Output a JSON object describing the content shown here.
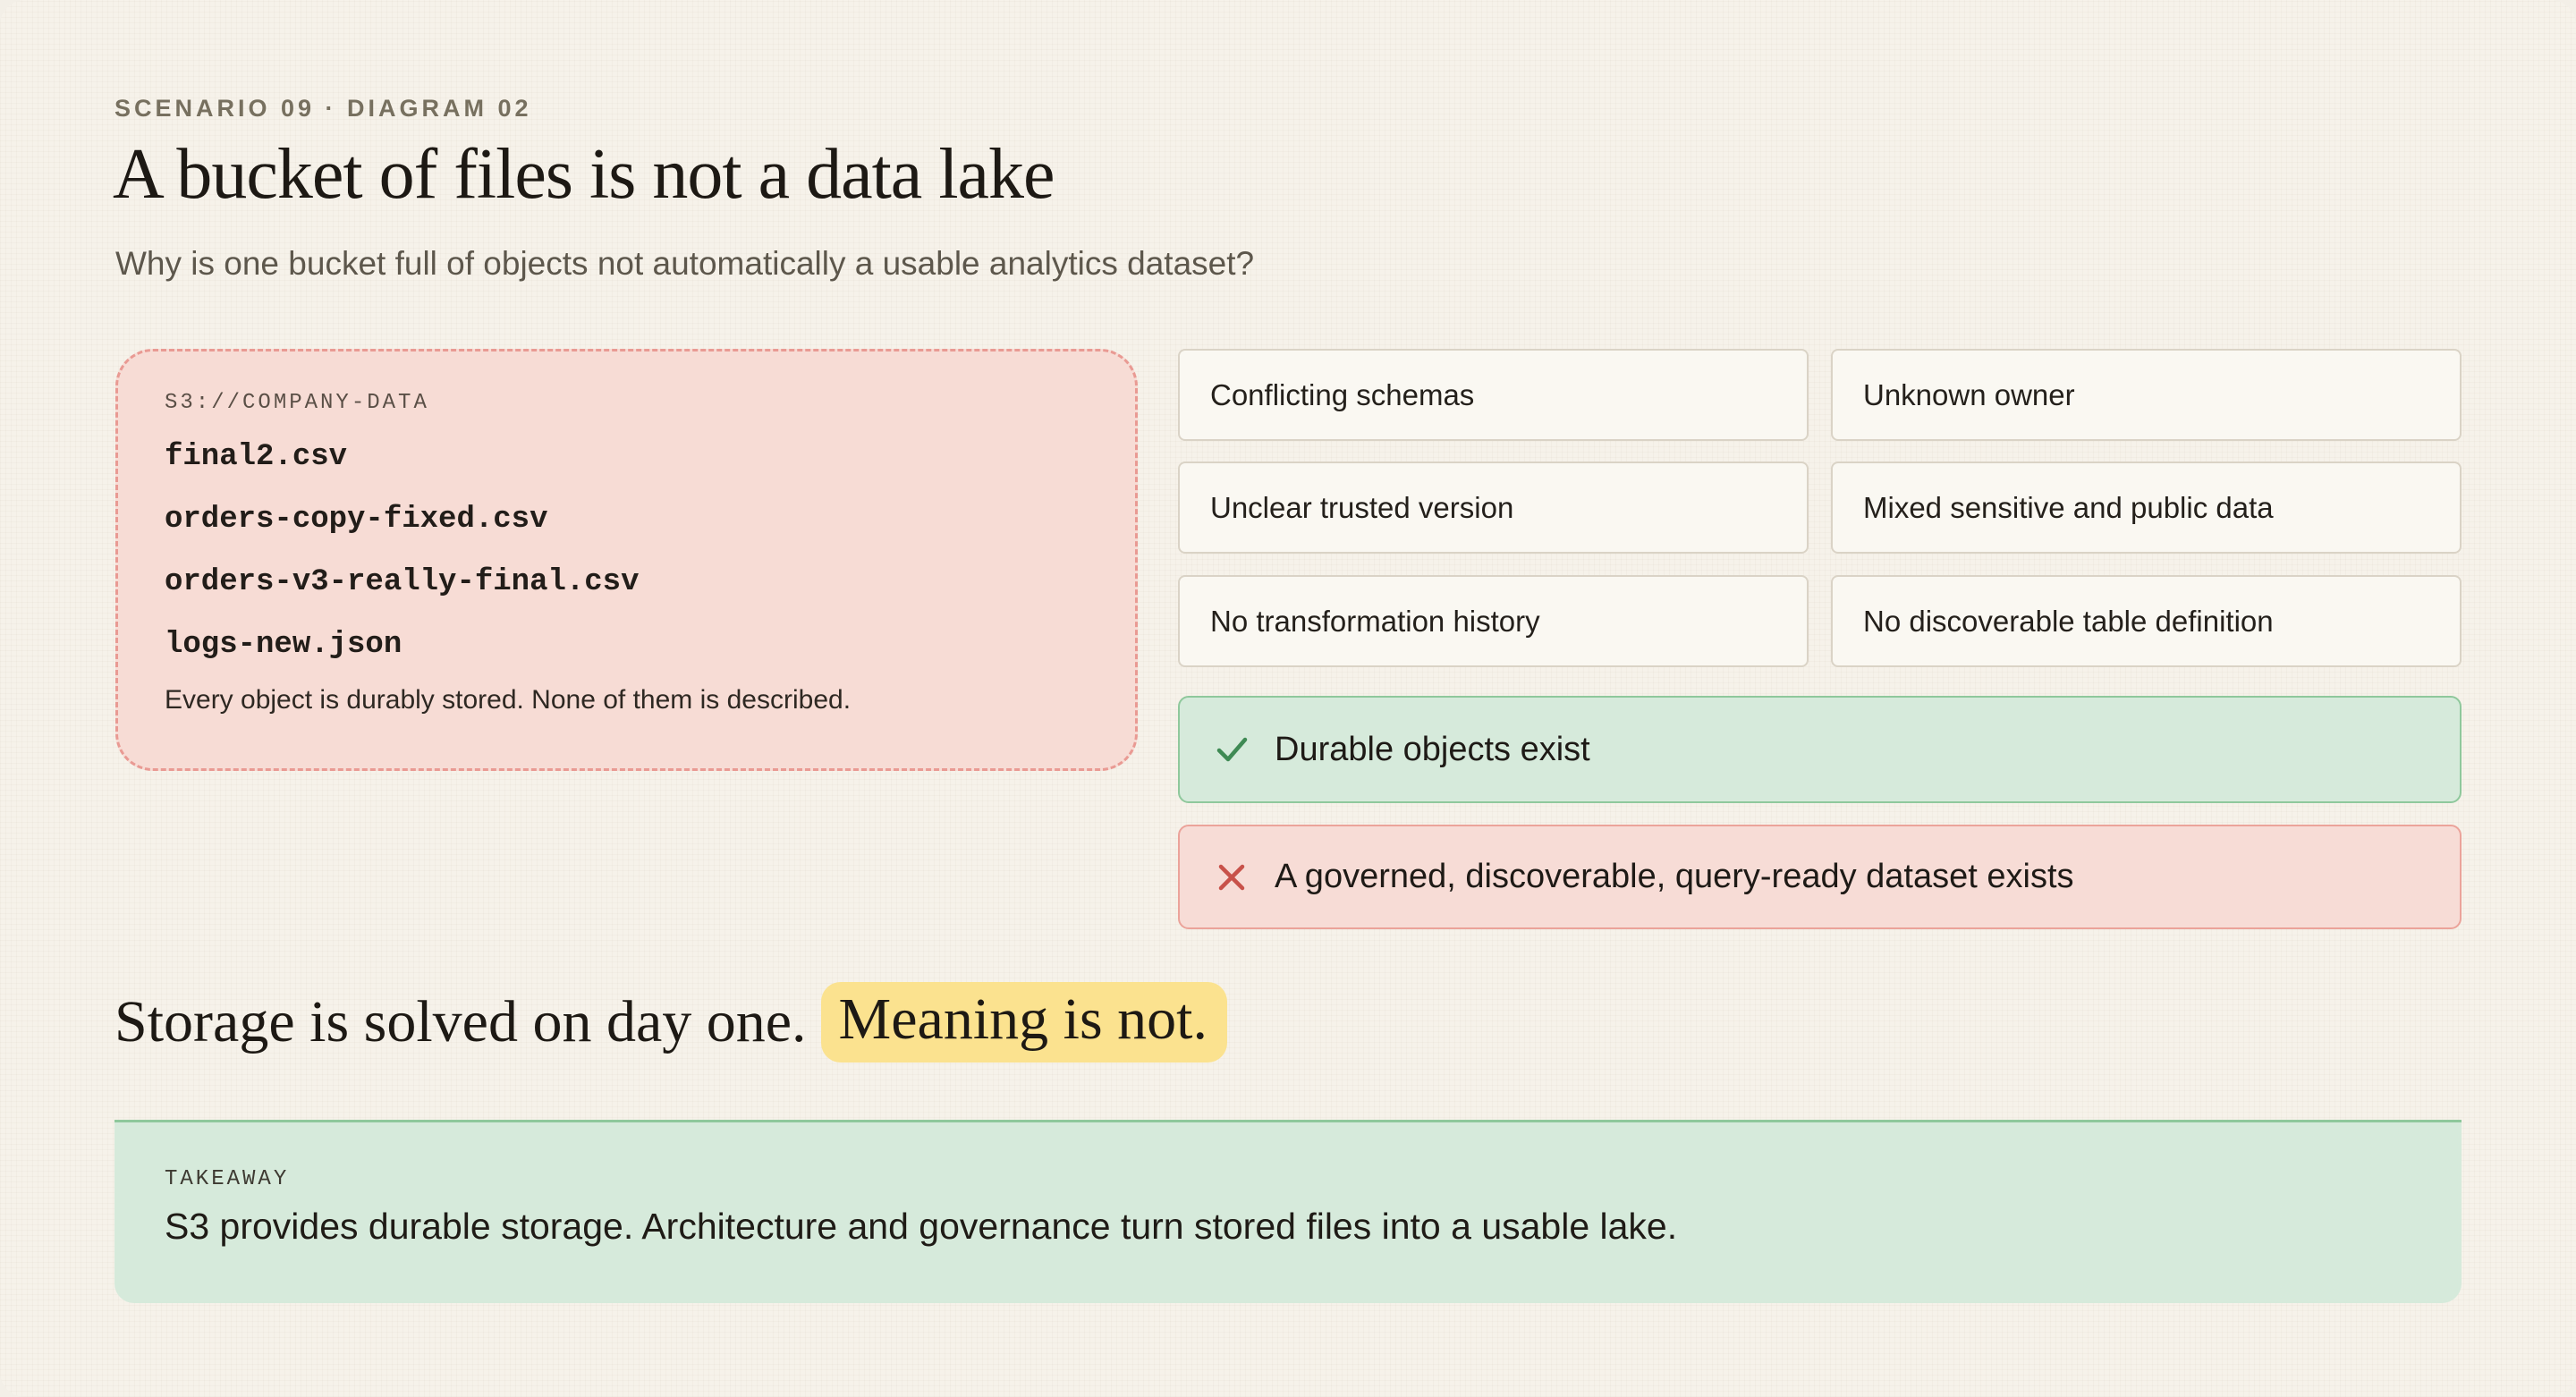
{
  "header": {
    "eyebrow": "SCENARIO 09 · DIAGRAM 02",
    "title": "A bucket of files is not a data lake",
    "subtitle": "Why is one bucket full of objects not automatically a usable analytics dataset?"
  },
  "bucket": {
    "label": "S3://COMPANY-DATA",
    "files": [
      "final2.csv",
      "orders-copy-fixed.csv",
      "orders-v3-really-final.csv",
      "logs-new.json"
    ],
    "note": "Every object is durably stored. None of them is described."
  },
  "problems": [
    "Conflicting schemas",
    "Unknown owner",
    "Unclear trusted version",
    "Mixed sensitive and public data",
    "No transformation history",
    "No discoverable table definition"
  ],
  "status": {
    "ok": {
      "text": "Durable objects exist",
      "icon": "check-icon",
      "color": "#3f8a54"
    },
    "bad": {
      "text": "A governed, discoverable, query-ready dataset exists",
      "icon": "x-icon",
      "color": "#c8524a"
    }
  },
  "punchline": {
    "lead": "Storage is solved on day one.",
    "highlight": "Meaning is not."
  },
  "takeaway": {
    "label": "TAKEAWAY",
    "text": "S3 provides durable storage. Architecture and governance turn stored files into a usable lake."
  },
  "colors": {
    "background": "#f6f2ea",
    "bucket_fill": "#f7dcd5",
    "bucket_border": "#e99a93",
    "ok_fill": "#d6eadb",
    "bad_fill": "#f7dcd6",
    "highlight": "#fbe28f"
  }
}
